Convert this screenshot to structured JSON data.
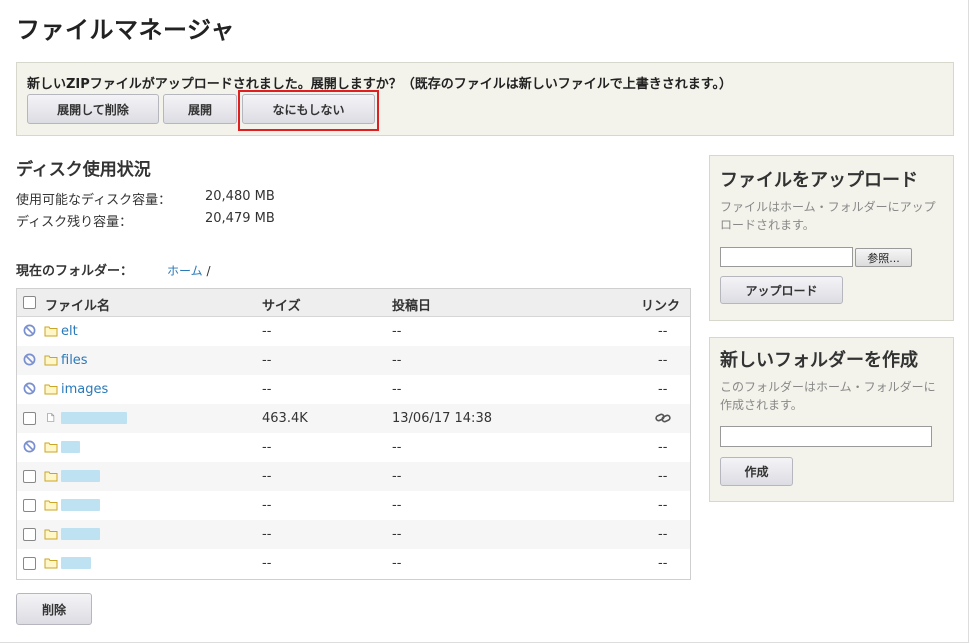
{
  "page": {
    "title": "ファイルマネージャ"
  },
  "notice": {
    "message": "新しいZIPファイルがアップロードされました。展開しますか？（既存のファイルは新しいファイルで上書きされます。）",
    "buttons": {
      "extract_delete": "展開して削除",
      "extract": "展開",
      "nothing": "なにもしない"
    }
  },
  "disk": {
    "heading": "ディスク使用状況",
    "available_label": "使用可能なディスク容量：",
    "available_value": "20,480 MB",
    "remaining_label": "ディスク残り容量：",
    "remaining_value": "20,479 MB"
  },
  "folder": {
    "label": "現在のフォルダー：",
    "home": "ホーム",
    "sep": "/"
  },
  "table": {
    "headers": {
      "name": "ファイル名",
      "size": "サイズ",
      "date": "投稿日",
      "link": "リンク"
    },
    "rows": [
      {
        "name": "elt",
        "size": "--",
        "date": "--",
        "link": "--"
      },
      {
        "name": "files",
        "size": "--",
        "date": "--",
        "link": "--"
      },
      {
        "name": "images",
        "size": "--",
        "date": "--",
        "link": "--"
      },
      {
        "name": "",
        "size": "463.4K",
        "date": "13/06/17 14:38",
        "link": ""
      },
      {
        "name": "",
        "size": "--",
        "date": "--",
        "link": "--"
      },
      {
        "name": "",
        "size": "--",
        "date": "--",
        "link": "--"
      },
      {
        "name": "",
        "size": "--",
        "date": "--",
        "link": "--"
      },
      {
        "name": "",
        "size": "--",
        "date": "--",
        "link": "--"
      },
      {
        "name": "",
        "size": "--",
        "date": "--",
        "link": "--"
      }
    ]
  },
  "delete_button": "削除",
  "upload": {
    "heading": "ファイルをアップロード",
    "desc": "ファイルはホーム・フォルダーにアップロードされます。",
    "browse": "参照...",
    "button": "アップロード"
  },
  "newfolder": {
    "heading": "新しいフォルダーを作成",
    "desc": "このフォルダーはホーム・フォルダーに作成されます。",
    "button": "作成"
  },
  "colors": {
    "link": "#2a79b8",
    "panel": "#f3f3eb",
    "highlight": "#e02020",
    "folder": "#e7c83c"
  }
}
